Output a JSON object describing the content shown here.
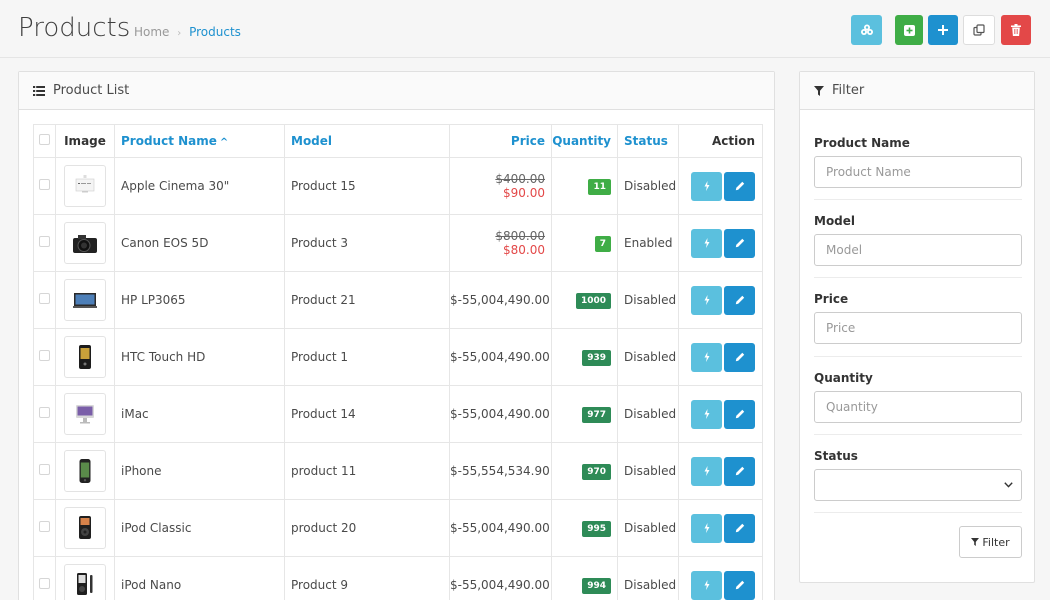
{
  "header": {
    "title": "Products",
    "breadcrumb": {
      "home": "Home",
      "separator": "›",
      "current": "Products"
    },
    "buttons": {
      "batch_icon": "cubes-icon",
      "add_icon": "plus-square-icon",
      "new_icon": "plus-icon",
      "copy_icon": "copy-icon",
      "delete_icon": "trash-icon"
    }
  },
  "list": {
    "title": "Product List",
    "columns": {
      "image": "Image",
      "name": "Product Name",
      "sort_indicator": "^",
      "model": "Model",
      "price": "Price",
      "quantity": "Quantity",
      "status": "Status",
      "action": "Action"
    },
    "rows": [
      {
        "image": "apple-cinema-thumb",
        "name": "Apple Cinema 30\"",
        "model": "Product 15",
        "price_old": "$400.00",
        "price": "$90.00",
        "quantity": "11",
        "status": "Disabled"
      },
      {
        "image": "canon-eos-thumb",
        "name": "Canon EOS 5D",
        "model": "Product 3",
        "price_old": "$800.00",
        "price": "$80.00",
        "quantity": "7",
        "status": "Enabled"
      },
      {
        "image": "hp-lp3065-thumb",
        "name": "HP LP3065",
        "model": "Product 21",
        "price_old": "",
        "price": "$-55,004,490.00",
        "quantity": "1000",
        "status": "Disabled"
      },
      {
        "image": "htc-touch-thumb",
        "name": "HTC Touch HD",
        "model": "Product 1",
        "price_old": "",
        "price": "$-55,004,490.00",
        "quantity": "939",
        "status": "Disabled"
      },
      {
        "image": "imac-thumb",
        "name": "iMac",
        "model": "Product 14",
        "price_old": "",
        "price": "$-55,004,490.00",
        "quantity": "977",
        "status": "Disabled"
      },
      {
        "image": "iphone-thumb",
        "name": "iPhone",
        "model": "product 11",
        "price_old": "",
        "price": "$-55,554,534.90",
        "quantity": "970",
        "status": "Disabled"
      },
      {
        "image": "ipod-classic-thumb",
        "name": "iPod Classic",
        "model": "product 20",
        "price_old": "",
        "price": "$-55,004,490.00",
        "quantity": "995",
        "status": "Disabled"
      },
      {
        "image": "ipod-nano-thumb",
        "name": "iPod Nano",
        "model": "Product 9",
        "price_old": "",
        "price": "$-55,004,490.00",
        "quantity": "994",
        "status": "Disabled"
      }
    ]
  },
  "filter": {
    "title": "Filter",
    "fields": {
      "product_name": {
        "label": "Product Name",
        "placeholder": "Product Name"
      },
      "model": {
        "label": "Model",
        "placeholder": "Model"
      },
      "price": {
        "label": "Price",
        "placeholder": "Price"
      },
      "quantity": {
        "label": "Quantity",
        "placeholder": "Quantity"
      },
      "status": {
        "label": "Status",
        "value": ""
      }
    },
    "button_label": "Filter"
  },
  "colors": {
    "primary": "#1e91cf",
    "info": "#5bc0de",
    "success": "#3fad46",
    "danger": "#e34848"
  }
}
